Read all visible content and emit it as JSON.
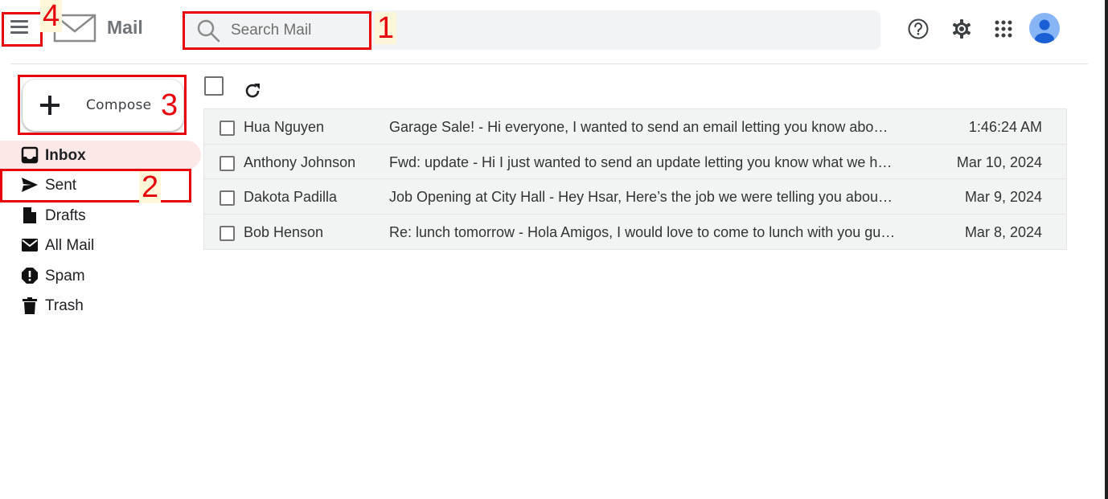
{
  "app": {
    "name": "Mail"
  },
  "search": {
    "placeholder": "Search Mail"
  },
  "header_icons": [
    "menu-icon",
    "mail-logo-icon",
    "search-icon",
    "help-icon",
    "gear-icon",
    "apps-icon",
    "avatar"
  ],
  "compose": {
    "label": "Compose"
  },
  "sidebar": {
    "items": [
      {
        "label": "Inbox",
        "icon": "inbox-icon",
        "active": true
      },
      {
        "label": "Sent",
        "icon": "send-icon"
      },
      {
        "label": "Drafts",
        "icon": "draft-icon"
      },
      {
        "label": "All Mail",
        "icon": "envelope-icon"
      },
      {
        "label": "Spam",
        "icon": "spam-icon"
      },
      {
        "label": "Trash",
        "icon": "trash-icon"
      }
    ]
  },
  "emails": [
    {
      "sender": "Hua Nguyen",
      "subject": "Garage Sale! - Hi everyone, I wanted to send an email letting you know about the …",
      "date": "1:46:24 AM"
    },
    {
      "sender": "Anthony Johnson",
      "subject": "Fwd: update - Hi I just wanted to send an update letting you know what we have …",
      "date": "Mar 10, 2024"
    },
    {
      "sender": "Dakota Padilla",
      "subject": "Job Opening at City Hall - Hey Hsar, Here’s the job we were telling you about. Let…",
      "date": "Mar 9, 2024"
    },
    {
      "sender": "Bob Henson",
      "subject": "Re: lunch tomorrow - Hola Amigos, I would love to come to lunch with you guys t…",
      "date": "Mar 8, 2024"
    }
  ],
  "annotations": [
    {
      "number": "1",
      "target": "search bar"
    },
    {
      "number": "2",
      "target": "Sent"
    },
    {
      "number": "3",
      "target": "Compose"
    },
    {
      "number": "4",
      "target": "menu"
    }
  ],
  "colors": {
    "active_nav_bg": "#fce8e6",
    "annotation": "#e8000b",
    "avatar": "#87b5f5",
    "list_bg": "#f2f4f4"
  }
}
